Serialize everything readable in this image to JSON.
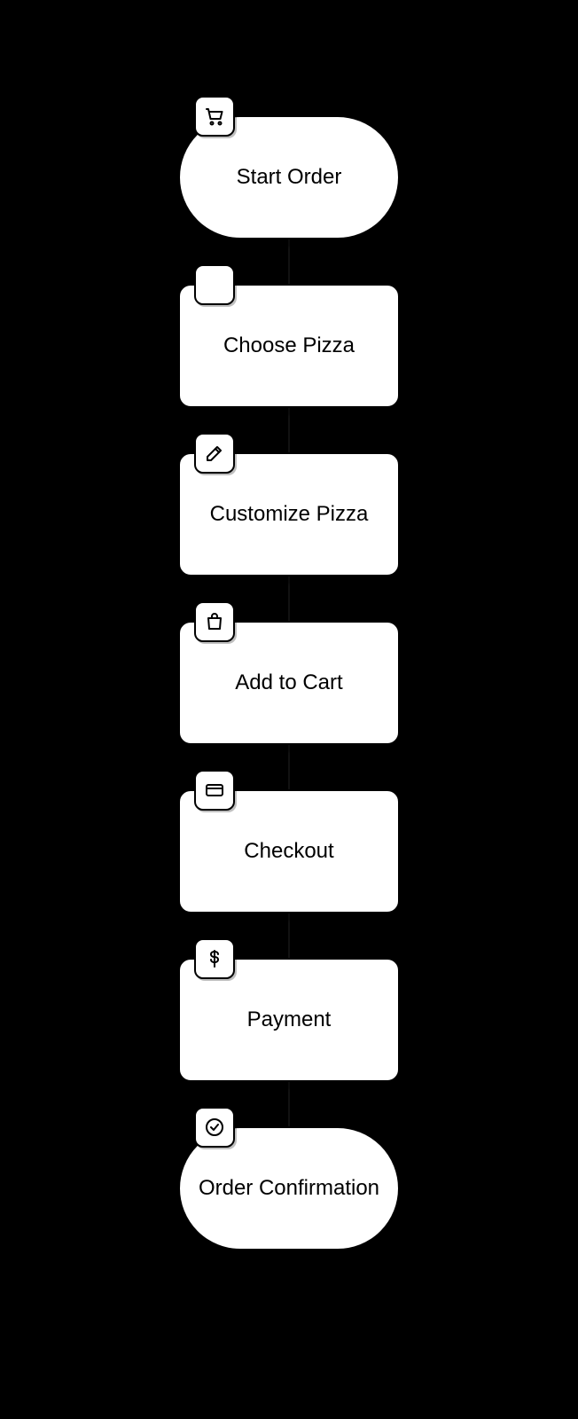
{
  "flow": {
    "nodes": [
      {
        "id": "start",
        "label": "Start Order",
        "icon": "cart-icon",
        "shape": "terminal"
      },
      {
        "id": "choose",
        "label": "Choose Pizza",
        "icon": "blank-icon",
        "shape": "process"
      },
      {
        "id": "customize",
        "label": "Customize Pizza",
        "icon": "edit-icon",
        "shape": "process"
      },
      {
        "id": "add-to-cart",
        "label": "Add to Cart",
        "icon": "shopping-bag-icon",
        "shape": "process"
      },
      {
        "id": "checkout",
        "label": "Checkout",
        "icon": "credit-card-icon",
        "shape": "process"
      },
      {
        "id": "payment",
        "label": "Payment",
        "icon": "dollar-icon",
        "shape": "process"
      },
      {
        "id": "confirm",
        "label": "Order Confirmation",
        "icon": "check-circle-icon",
        "shape": "terminal"
      }
    ]
  }
}
